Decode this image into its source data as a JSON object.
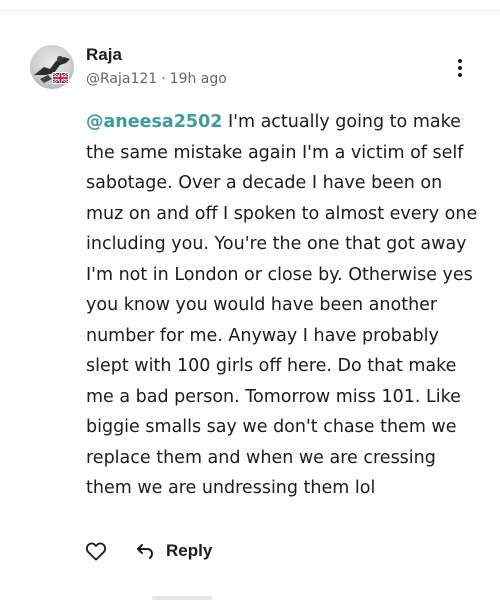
{
  "comment": {
    "author_name": "Raja",
    "handle": "@Raja121",
    "separator": "·",
    "time_ago": "19h ago",
    "avatar_flag": "uk-flag",
    "mention": "@aneesa2502",
    "body": " I'm actually going to make the same mistake again I'm a victim of self sabotage. Over a decade I have been on muz on and off I spoken to almost every one including you. You're the one that got away I'm not in London or close by. Otherwise yes you know you would have been another number for me. Anyway I have probably slept with 100 girls off here. Do that make me a bad person. Tomorrow miss 101. Like biggie smalls say we don't chase them we replace them and when we are cressing them we are undressing them lol",
    "mention_color": "#3e9c9d"
  },
  "actions": {
    "like_icon": "heart-outline-icon",
    "reply_icon": "reply-arrow-icon",
    "reply_label": "Reply"
  },
  "menu_icon": "more-vertical-icon"
}
